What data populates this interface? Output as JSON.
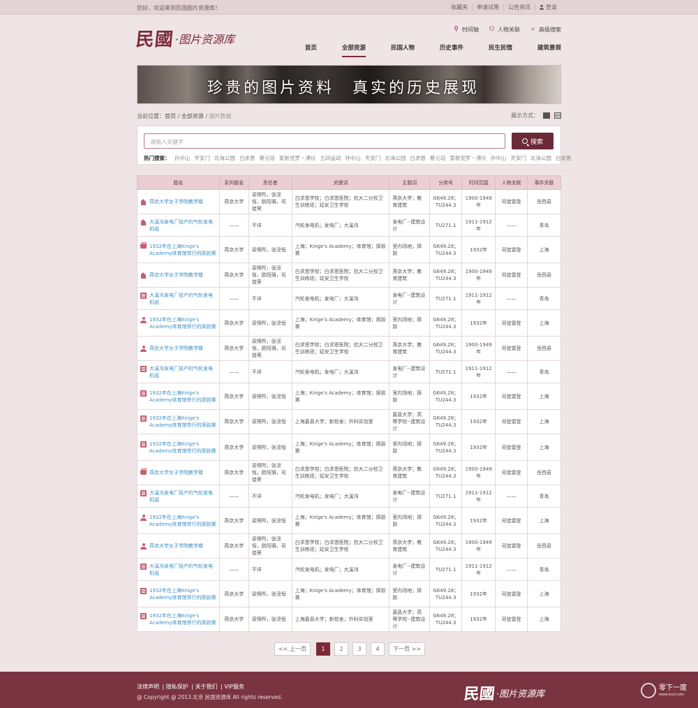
{
  "topbar": {
    "welcome": "您好，欢迎来到民国图片资源库！",
    "links": [
      "收藏夹",
      "申请试用",
      "公告资讯",
      "登录"
    ]
  },
  "logo": {
    "big": "民國",
    "small": "·图片资源库"
  },
  "tools": [
    {
      "label": "时间轴",
      "icon": "location-icon"
    },
    {
      "label": "人物关联",
      "icon": "people-icon"
    },
    {
      "label": "高级搜索",
      "icon": "search-icon"
    }
  ],
  "nav": [
    "首页",
    "全部资源",
    "民国人物",
    "历史事件",
    "民生民情",
    "建筑景观"
  ],
  "nav_active": 1,
  "banner": {
    "text": "珍贵的图片资料　真实的历史展现"
  },
  "breadcrumb": {
    "label": "当前位置：",
    "items": [
      "首页",
      "全部资源",
      "图片数据"
    ]
  },
  "view": {
    "label": "展示方式："
  },
  "search": {
    "placeholder": "请输入关键字",
    "button": "搜索",
    "hot_label": "热门搜索：",
    "hot_words": [
      "孙中山",
      "天安门",
      "北海公园",
      "白求恩",
      "蔡元培",
      "爱新觉罗・溥仪",
      "五四运动",
      "孙中山",
      "天安门",
      "北海公园",
      "白求恩",
      "蔡元培",
      "爱新觉罗・溥仪",
      "孙中山",
      "天安门",
      "北海公园",
      "白求恩"
    ]
  },
  "table": {
    "headers": [
      "题名",
      "系列题名",
      "责任者",
      "关键词",
      "主题词",
      "分类号",
      "时间范围",
      "人物关联",
      "事件关联"
    ],
    "rows": [
      {
        "icon": "build",
        "title": "燕京大学女子学院教学楼",
        "series": "燕京大学",
        "author": "梁得所，张滂恒，欧阳璜，司徒荣",
        "keywords": "白求恩学校；白求恩医院；抗大二分校卫生训练班；延安卫生学校",
        "subject": "燕京大学；教育建筑",
        "classno": "G649.28；TU244.3",
        "time": "1900-1949年",
        "person": "司徒雷登",
        "event": "岳西县"
      },
      {
        "icon": "build",
        "title": "大溪沟发电厂投产的气轮发电机组",
        "series": "——",
        "author": "不详",
        "keywords": "汽轮发电机；发电厂；大溪沟",
        "subject": "发电厂--建筑设计",
        "classno": "TU271.1",
        "time": "1911-1912年",
        "person": "——",
        "event": "青岛"
      },
      {
        "icon": "bag",
        "title": "1932年在上海Knige's Academy体育馆举行的摔跤赛",
        "series": "燕京大学",
        "author": "梁得所，张滂恒",
        "keywords": "上海；Knige's Academy；体育馆；摔跤赛",
        "subject": "室内场地；摔跤",
        "classno": "G649.28；TU244.3",
        "time": "1932年",
        "person": "司徒雷登",
        "event": "上海"
      },
      {
        "icon": "build",
        "title": "燕京大学女子学院教学楼",
        "series": "燕京大学",
        "author": "梁得所，张滂恒，欧阳璜，司徒荣",
        "keywords": "白求恩学校；白求恩医院；抗大二分校卫生训练班；延安卫生学校",
        "subject": "燕京大学；教育建筑",
        "classno": "G649.28；TU244.3",
        "time": "1900-1949年",
        "person": "司徒雷登",
        "event": "岳西县"
      },
      {
        "icon": "book",
        "title": "大溪沟发电厂投产的气轮发电机组",
        "series": "——",
        "author": "不详",
        "keywords": "汽轮发电机；发电厂；大溪沟",
        "subject": "发电厂--建筑设计",
        "classno": "TU271.1",
        "time": "1911-1912年",
        "person": "——",
        "event": "青岛"
      },
      {
        "icon": "person",
        "title": "1932年在上海Knige's Academy体育馆举行的摔跤赛",
        "series": "燕京大学",
        "author": "梁得所，张滂恒",
        "keywords": "上海；Knige's Academy；体育馆；摔跤赛",
        "subject": "室内场地；摔跤",
        "classno": "G649.28；TU244.3",
        "time": "1932年",
        "person": "司徒雷登",
        "event": "上海"
      },
      {
        "icon": "person",
        "title": "燕京大学女子学院教学楼",
        "series": "燕京大学",
        "author": "梁得所，张滂恒，欧阳璜，司徒荣",
        "keywords": "白求恩学校；白求恩医院；抗大二分校卫生训练班；延安卫生学校",
        "subject": "燕京大学；教育建筑",
        "classno": "G649.28；TU244.3",
        "time": "1900-1949年",
        "person": "司徒雷登",
        "event": "岳西县"
      },
      {
        "icon": "book",
        "title": "大溪沟发电厂投产的气轮发电机组",
        "series": "——",
        "author": "不详",
        "keywords": "汽轮发电机；发电厂；大溪沟",
        "subject": "发电厂--建筑设计",
        "classno": "TU271.1",
        "time": "1911-1912年",
        "person": "——",
        "event": "青岛"
      },
      {
        "icon": "book",
        "title": "1932年在上海Knige's Academy体育馆举行的摔跤赛",
        "series": "燕京大学",
        "author": "梁得所，张滂恒",
        "keywords": "上海；Knige's Academy；体育馆；摔跤赛",
        "subject": "室内场地；摔跤",
        "classno": "G649.28；TU244.3",
        "time": "1932年",
        "person": "司徒雷登",
        "event": "上海"
      },
      {
        "icon": "book",
        "title": "1932年在上海Knige's Academy体育馆举行的摔跤赛",
        "series": "燕京大学",
        "author": "梁得所，张滂恒",
        "keywords": "上海嘉县大学；新校舍；外科实验室",
        "subject": "嘉县大学；高等学校--建筑设计",
        "classno": "G649.28；TU244.3",
        "time": "1932年",
        "person": "司徒雷登",
        "event": "上海"
      },
      {
        "icon": "book",
        "title": "1932年在上海Knige's Academy体育馆举行的摔跤赛",
        "series": "燕京大学",
        "author": "梁得所，张滂恒",
        "keywords": "上海；Knige's Academy；体育馆；摔跤赛",
        "subject": "室内场地；摔跤",
        "classno": "G649.28；TU244.3",
        "time": "1932年",
        "person": "司徒雷登",
        "event": "上海"
      },
      {
        "icon": "bag",
        "title": "燕京大学女子学院教学楼",
        "series": "燕京大学",
        "author": "梁得所，张滂恒，欧阳璜，司徒荣",
        "keywords": "白求恩学校；白求恩医院；抗大二分校卫生训练班；延安卫生学校",
        "subject": "燕京大学；教育建筑",
        "classno": "G649.28；TU244.3",
        "time": "1900-1949年",
        "person": "司徒雷登",
        "event": "岳西县"
      },
      {
        "icon": "book",
        "title": "大溪沟发电厂投产的气轮发电机组",
        "series": "——",
        "author": "不详",
        "keywords": "汽轮发电机；发电厂；大溪沟",
        "subject": "发电厂--建筑设计",
        "classno": "TU271.1",
        "time": "1911-1912年",
        "person": "——",
        "event": "青岛"
      },
      {
        "icon": "person",
        "title": "1932年在上海Knige's Academy体育馆举行的摔跤赛",
        "series": "燕京大学",
        "author": "梁得所，张滂恒",
        "keywords": "上海；Knige's Academy；体育馆；摔跤赛",
        "subject": "室内场地；摔跤",
        "classno": "G649.28；TU244.3",
        "time": "1932年",
        "person": "司徒雷登",
        "event": "上海"
      },
      {
        "icon": "person",
        "title": "燕京大学女子学院教学楼",
        "series": "燕京大学",
        "author": "梁得所，张滂恒，欧阳璜，司徒荣",
        "keywords": "白求恩学校；白求恩医院；抗大二分校卫生训练班；延安卫生学校",
        "subject": "燕京大学；教育建筑",
        "classno": "G649.28；TU244.3",
        "time": "1900-1949年",
        "person": "司徒雷登",
        "event": "岳西县"
      },
      {
        "icon": "book",
        "title": "大溪沟发电厂投产的气轮发电机组",
        "series": "——",
        "author": "不详",
        "keywords": "汽轮发电机；发电厂；大溪沟",
        "subject": "发电厂--建筑设计",
        "classno": "TU271.1",
        "time": "1911-1912年",
        "person": "——",
        "event": "青岛"
      },
      {
        "icon": "book",
        "title": "1932年在上海Knige's Academy体育馆举行的摔跤赛",
        "series": "燕京大学",
        "author": "梁得所，张滂恒",
        "keywords": "上海；Knige's Academy；体育馆；摔跤赛",
        "subject": "室内场地；摔跤",
        "classno": "G649.28；TU244.3",
        "time": "1932年",
        "person": "司徒雷登",
        "event": "上海"
      },
      {
        "icon": "book",
        "title": "1932年在上海Knige's Academy体育馆举行的摔跤赛",
        "series": "燕京大学",
        "author": "梁得所，张滂恒",
        "keywords": "上海嘉县大学；新校舍；外科实验室",
        "subject": "嘉县大学；高等学校--建筑设计",
        "classno": "G649.28；TU244.3",
        "time": "1932年",
        "person": "司徒雷登",
        "event": "上海"
      }
    ]
  },
  "pager": {
    "prev": "<< 上一页",
    "next": "下一页 >>",
    "pages": [
      "1",
      "2",
      "3",
      "4"
    ],
    "current": 0
  },
  "footer": {
    "links": [
      "法律声明",
      "隐私保护",
      "关于我们",
      "VIP服务"
    ],
    "copyright": "@ Copyright @ 2013.北京 民国资源库 All rights reserved.",
    "logo_big": "民國",
    "logo_small": "·图片资源库"
  },
  "watermark": {
    "t1": "零下一度",
    "t2": "www.lxyd.com"
  },
  "colors": {
    "accent": "#7c2a38",
    "header_bg": "#e9cfd3",
    "link": "#3d8fc4",
    "page_bg": "#efe4e6"
  }
}
